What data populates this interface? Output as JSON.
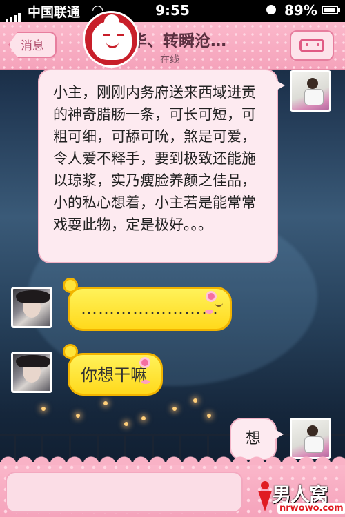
{
  "status_bar": {
    "carrier": "中国联通",
    "time": "9:55",
    "battery_percent": "89%",
    "battery_level": 0.89,
    "icons": [
      "signal-bars-icon",
      "wifi-icon",
      "clock-lock-icon",
      "battery-icon"
    ]
  },
  "nav": {
    "back_label": "消息",
    "title": "华、转瞬沧…",
    "subtitle": "在线",
    "menu_icon": "emoticon-face-icon",
    "logo_icon": "app-logo-icon"
  },
  "messages": [
    {
      "side": "right",
      "sender": "me",
      "text": "小主，刚刚内务府送来西域进贡的神奇腊肠一条，可长可短，可粗可细，可舔可吮，煞是可爱，令人爱不释手，要到极致还能施以琼浆，实乃瘦脸养颜之佳品，小的私心想着，小主若是能常常戏耍此物，定是极好。。。"
    },
    {
      "side": "left",
      "sender": "her",
      "text": "……………………"
    },
    {
      "side": "left",
      "sender": "her",
      "text": "你想干嘛"
    },
    {
      "side": "right",
      "sender": "me",
      "text": "想"
    }
  ],
  "input": {
    "value": "",
    "placeholder": ""
  },
  "watermark": {
    "text": "男人窝",
    "url": "nrwowo.com"
  },
  "colors": {
    "nav_pink": "#f5a3bb",
    "bubble_pink": "#fdeaf0",
    "bubble_yellow": "#ffe43a",
    "logo_red": "#c81f2a"
  }
}
